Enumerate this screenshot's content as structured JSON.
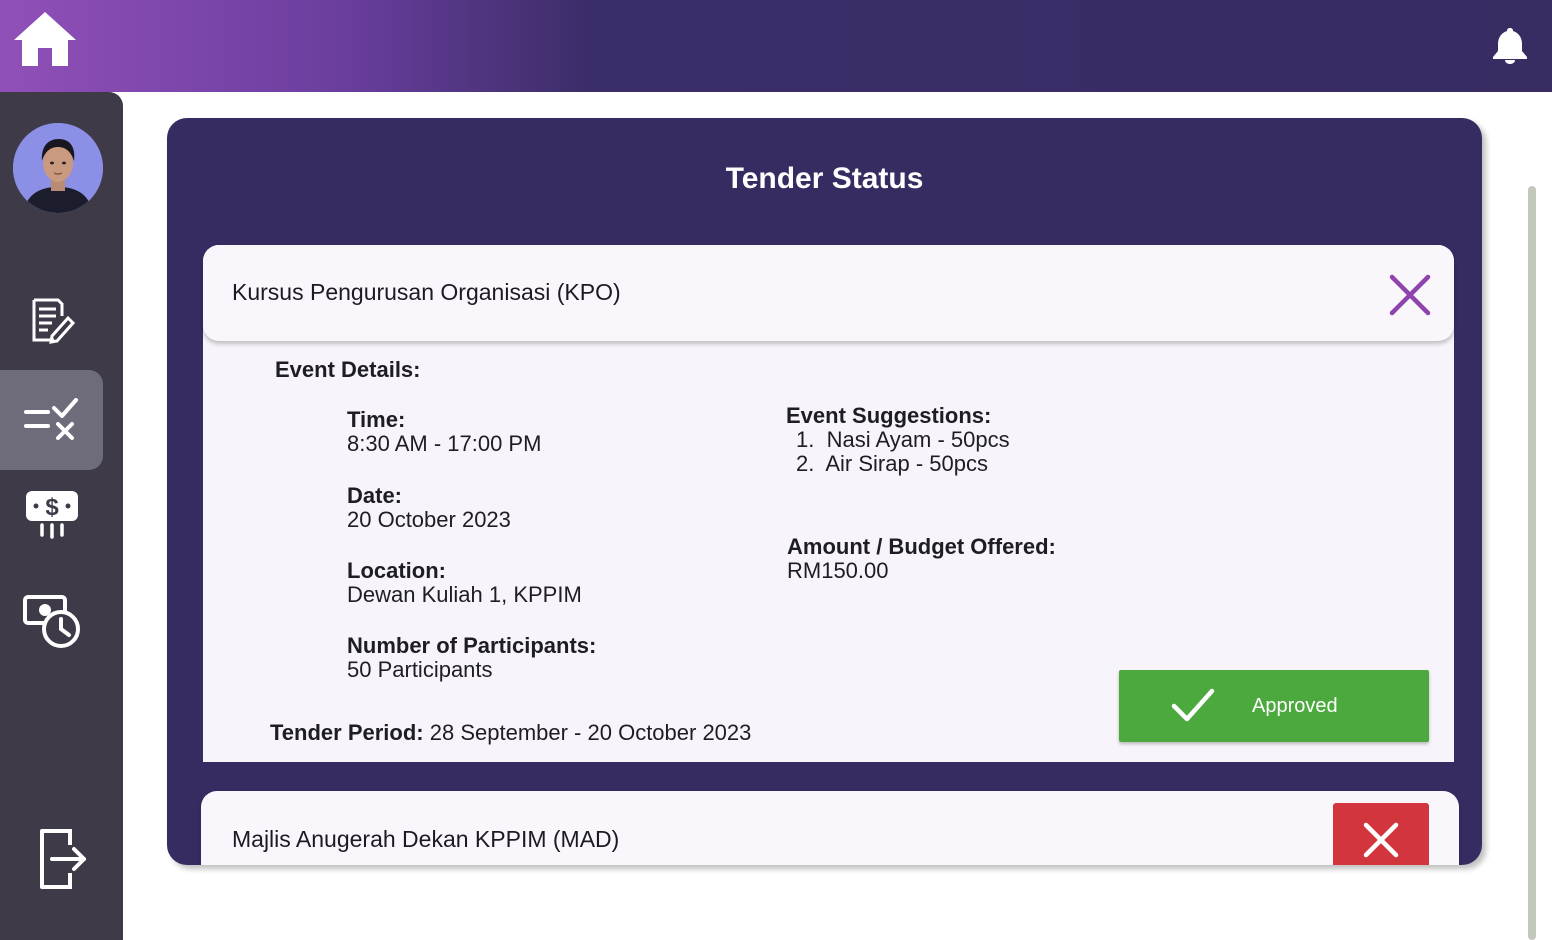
{
  "header": {
    "home_icon": "home-icon",
    "notification_icon": "bell-icon"
  },
  "sidebar": {
    "items": [
      {
        "icon": "edit-document-icon",
        "active": false
      },
      {
        "icon": "tender-status-icon",
        "active": true
      },
      {
        "icon": "payment-icon",
        "active": false
      },
      {
        "icon": "payment-history-icon",
        "active": false
      }
    ],
    "logout_icon": "logout-icon"
  },
  "page": {
    "title": "Tender Status"
  },
  "tenders": [
    {
      "title": "Kursus Pengurusan Organisasi (KPO)",
      "details_heading": "Event Details:",
      "time_label": "Time:",
      "time_value": "8:30 AM - 17:00 PM",
      "date_label": "Date:",
      "date_value": "20 October 2023",
      "location_label": "Location:",
      "location_value": "Dewan Kuliah 1, KPPIM",
      "participants_label": "Number of Participants:",
      "participants_value": "50 Participants",
      "suggestions_label": "Event Suggestions:",
      "suggestions": [
        "Nasi Ayam - 50pcs",
        "Air Sirap - 50pcs"
      ],
      "amount_label": "Amount / Budget Offered:",
      "amount_value": "RM150.00",
      "period_label": "Tender Period:",
      "period_value": "28 September - 20 October 2023",
      "status_label": "Approved"
    },
    {
      "title": "Majlis Anugerah Dekan KPPIM (MAD)"
    }
  ],
  "colors": {
    "primary": "#372c61",
    "accent_purple": "#8e44ad",
    "approved": "#4ba93d",
    "rejected": "#d2353e"
  }
}
